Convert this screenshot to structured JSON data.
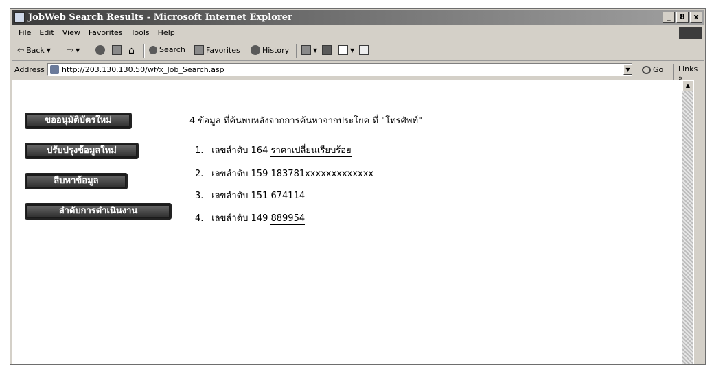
{
  "window": {
    "title": "JobWeb Search Results - Microsoft Internet Explorer",
    "controls": [
      "_",
      "8",
      "x"
    ]
  },
  "menu": [
    "File",
    "Edit",
    "View",
    "Favorites",
    "Tools",
    "Help"
  ],
  "toolbar": {
    "back": "Back",
    "search": "Search",
    "favorites": "Favorites",
    "history": "History"
  },
  "address": {
    "label": "Address",
    "url": "http://203.130.130.50/wf/x_Job_Search.asp",
    "go": "Go",
    "links": "Links »"
  },
  "sidebar": {
    "buttons": [
      "ขออนุมัติบัตรใหม่",
      "ปรับปรุงข้อมูลใหม่",
      "สืบหาข้อมูล",
      "ลำดับการดำเนินงาน"
    ]
  },
  "results": {
    "headline": "4 ข้อมูล ที่ค้นพบหลังจากการค้นหาจากประโยค ที่ \"โทรศัพท์\"",
    "items": [
      {
        "num": "1.",
        "prefix": "เลขลำดับ 164",
        "link": "ราคาเปลี่ยนเรียบร้อย"
      },
      {
        "num": "2.",
        "prefix": "เลขลำดับ 159",
        "link": "183781xxxxxxxxxxxxx"
      },
      {
        "num": "3.",
        "prefix": "เลขลำดับ 151",
        "link": "674114"
      },
      {
        "num": "4.",
        "prefix": "เลขลำดับ 149",
        "link": "889954"
      }
    ]
  }
}
